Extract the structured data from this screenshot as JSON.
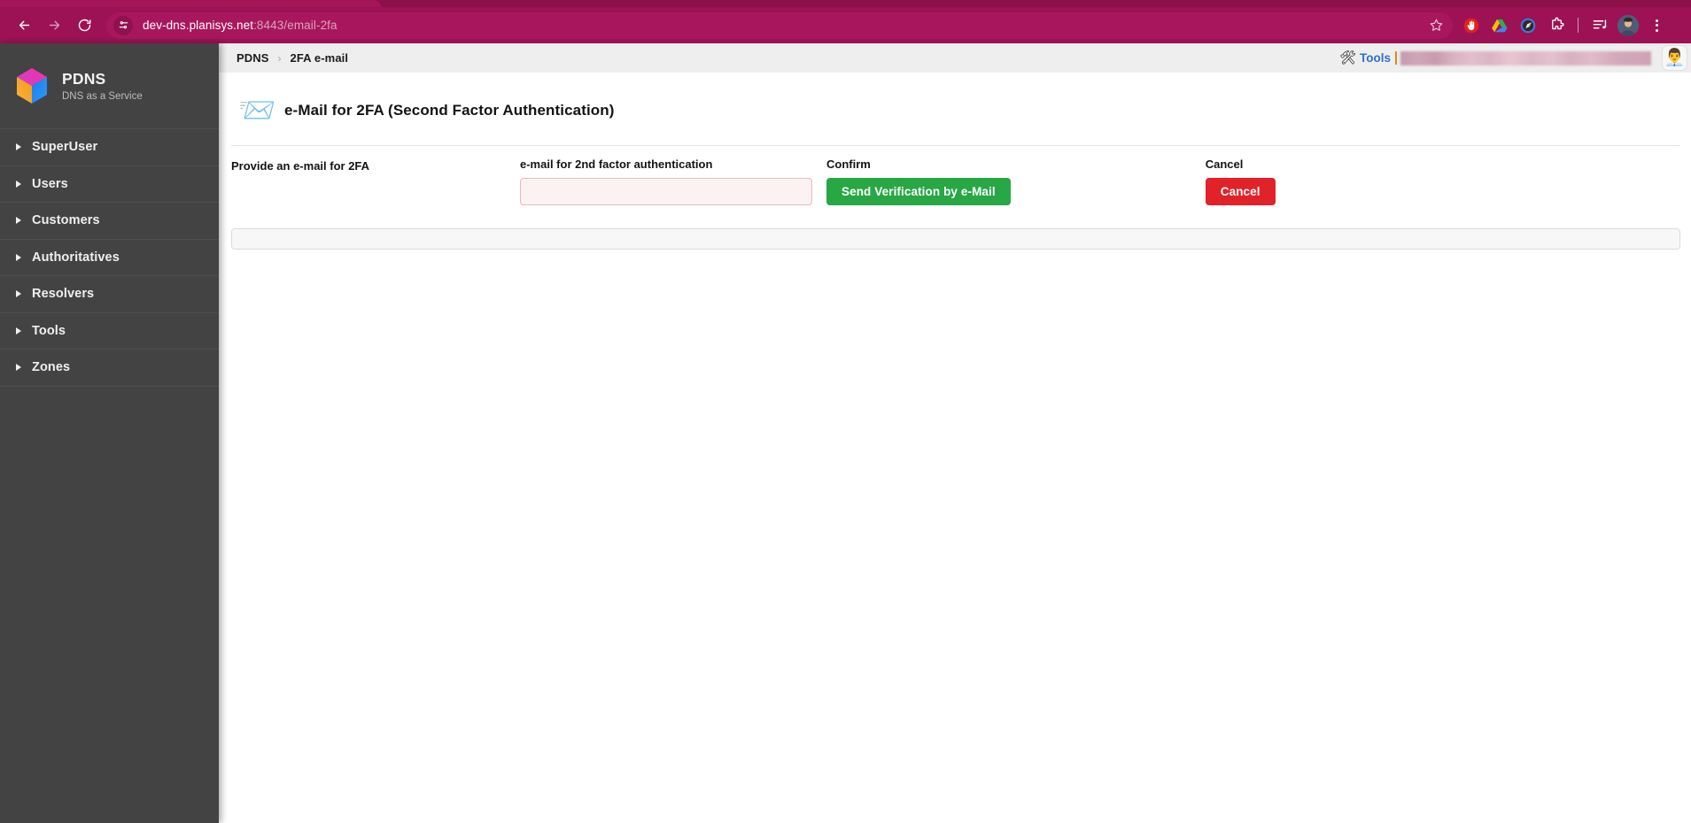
{
  "browser": {
    "back_icon": "back-arrow-icon",
    "forward_icon": "forward-arrow-icon",
    "reload_icon": "reload-icon",
    "site_info_icon": "site-settings-icon",
    "url_host": "dev-dns.planisys.net",
    "url_rest": ":8443/email-2fa",
    "bookmark_icon": "star-icon",
    "extensions": [
      {
        "name": "ublock-origin-icon",
        "glyph": "✋"
      },
      {
        "name": "google-drive-icon",
        "glyph": "▲"
      },
      {
        "name": "compass-extension-icon",
        "glyph": "🧭"
      },
      {
        "name": "extensions-puzzle-icon",
        "glyph": "🧩"
      },
      {
        "name": "media-playlist-icon",
        "glyph": "🎵"
      }
    ],
    "profile_avatar_icon": "profile-avatar",
    "profile_avatar_glyph": "👤",
    "menu_icon": "three-dot-menu-icon"
  },
  "sidebar": {
    "brand_name": "PDNS",
    "brand_subtitle": "DNS as a Service",
    "logo_icon": "pdns-cube-logo",
    "items": [
      {
        "label": "SuperUser"
      },
      {
        "label": "Users"
      },
      {
        "label": "Customers"
      },
      {
        "label": "Authoritatives"
      },
      {
        "label": "Resolvers"
      },
      {
        "label": "Tools"
      },
      {
        "label": "Zones"
      }
    ]
  },
  "topbar": {
    "breadcrumb": [
      "PDNS",
      "2FA e-mail"
    ],
    "breadcrumb_separator": "›",
    "tools_icon": "hammer-and-wrench-icon",
    "tools_icon_glyph": "🛠",
    "tools_label": "Tools",
    "redacted_field": "",
    "user_avatar_icon": "office-worker-avatar",
    "user_avatar_glyph": "👨‍💼"
  },
  "main": {
    "header_icon": "incoming-envelope-icon",
    "header_icon_glyph": "📨",
    "title": "e-Mail for 2FA (Second Factor Authentication)",
    "intro": "Provide an e-mail for 2FA",
    "email_field": {
      "label": "e-mail for 2nd factor authentication",
      "value": "",
      "placeholder": ""
    },
    "confirm": {
      "label": "Confirm",
      "button": "Send Verification by e-Mail"
    },
    "cancel": {
      "label": "Cancel",
      "button": "Cancel"
    },
    "message_panel": ""
  },
  "colors": {
    "browser_chrome": "#9c1255",
    "sidebar": "#434343",
    "confirm_green": "#28a745",
    "cancel_red": "#e12228",
    "link_blue": "#2f6fd0",
    "input_error_bg": "#fdf2f2",
    "input_error_border": "#e7b9bc"
  }
}
